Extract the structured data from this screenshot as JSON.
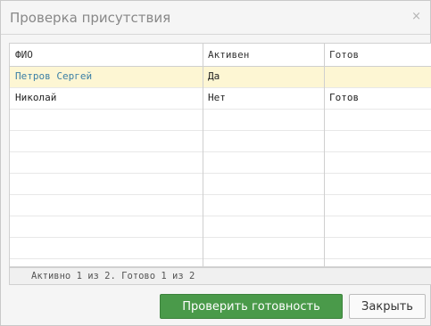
{
  "dialog": {
    "title": "Проверка присутствия",
    "close_glyph": "×",
    "close_icon": "close-icon"
  },
  "table": {
    "columns": [
      "ФИО",
      "Активен",
      "Готов"
    ],
    "rows": [
      {
        "name": "Петров Сергей",
        "active": "Да",
        "ready": "",
        "selected": true
      },
      {
        "name": "Николай",
        "active": "Нет",
        "ready": "Готов",
        "selected": false
      }
    ]
  },
  "status": {
    "text": "Активно 1 из 2. Готово 1 из 2"
  },
  "buttons": {
    "check_ready": "Проверить готовность",
    "close": "Закрыть"
  },
  "colors": {
    "primary_button": "#4a9a4a",
    "selected_row": "#fdf6d3",
    "link_text": "#3b7fa6"
  }
}
